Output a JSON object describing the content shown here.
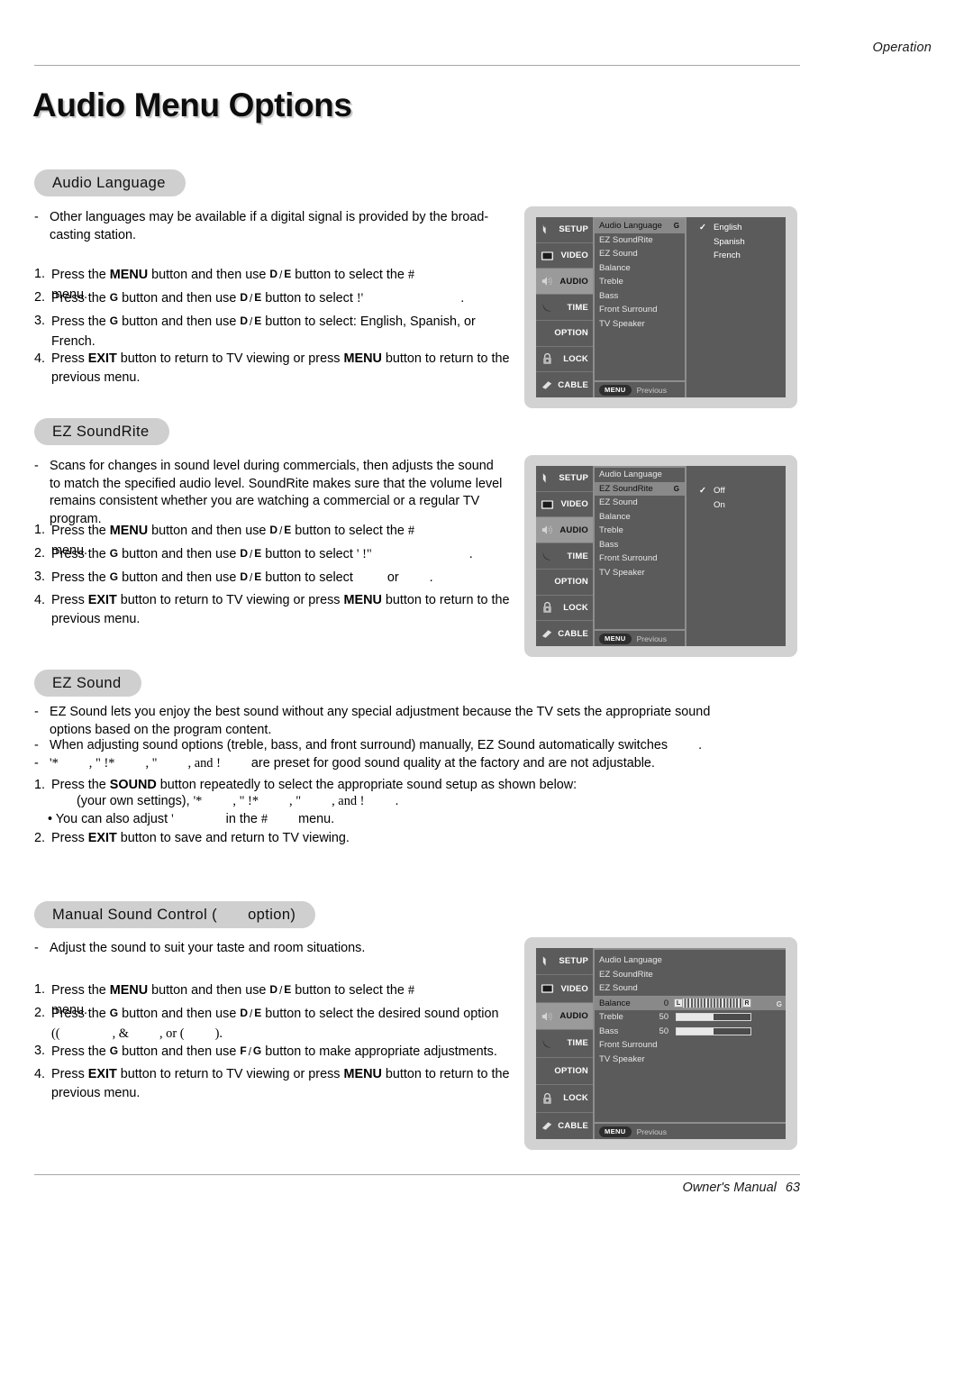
{
  "header": {
    "running_head": "Operation"
  },
  "title": "Audio Menu Options",
  "footer": {
    "manual_label": "Owner's Manual",
    "page_number": "63"
  },
  "sections": {
    "audio_language": {
      "pill": "Audio Language",
      "note": "Other languages may be available if a digital signal is provided by the broad-casting station.",
      "note_l1": "Other languages may be available if a digital signal is provided by the broad-",
      "note_l2": "casting station.",
      "steps": [
        {
          "n": "1.",
          "pre": "Press the ",
          "b1": "MENU",
          "mid": " button and then use ",
          "k1": "D",
          "sep": "/",
          "k2": "E",
          "post": " button to select the ",
          "sym": "#",
          "tail": "menu."
        },
        {
          "n": "2.",
          "pre": "Press the ",
          "k1": "G",
          "mid": " button and then use ",
          "k2": "D",
          "sep": "/",
          "k3": "E",
          "post": " button to select ",
          "sym": "!'",
          "tail": "."
        },
        {
          "n": "3.",
          "pre": "Press the ",
          "k1": "G",
          "mid": " button and then use ",
          "k2": "D",
          "sep": "/",
          "k3": "E",
          "post": " button to select: English, Spanish, or",
          "l2": "French."
        },
        {
          "n": "4.",
          "pre": "Press ",
          "b1": "EXIT",
          "mid": " button to return to TV viewing or press ",
          "b2": "MENU",
          "post": " button to return to the",
          "l2": "previous menu."
        }
      ]
    },
    "ez_soundrite": {
      "pill": "EZ SoundRite",
      "note_l1": "Scans for changes in sound level during commercials, then adjusts the sound",
      "note_l2": "to match the specified audio level. SoundRite makes sure that the volume level",
      "note_l3": "remains consistent whether you are watching a commercial or a regular TV",
      "note_l4": "program.",
      "steps": [
        {
          "n": "1.",
          "pre": "Press the ",
          "b1": "MENU",
          "mid": " button and then use ",
          "k1": "D",
          "sep": "/",
          "k2": "E",
          "post": " button to select the ",
          "sym": "#",
          "tail": "menu."
        },
        {
          "n": "2.",
          "pre": "Press the ",
          "k1": "G",
          "mid": " button and then use ",
          "k2": "D",
          "sep": "/",
          "k3": "E",
          "post": " button to select ",
          "sym": "' !\"",
          "tail": "."
        },
        {
          "n": "3.",
          "pre": "Press the ",
          "k1": "G",
          "mid": " button and then use ",
          "k2": "D",
          "sep": "/",
          "k3": "E",
          "post": " button to select ",
          "sym": "",
          "tail": "or",
          "tail2": "."
        },
        {
          "n": "4.",
          "pre": "Press ",
          "b1": "EXIT",
          "mid": " button to return to TV viewing or press ",
          "b2": "MENU",
          "post": " button to return to the",
          "l2": "previous menu."
        }
      ]
    },
    "ez_sound": {
      "pill": "EZ Sound",
      "note1_l1": "EZ Sound lets you enjoy the best sound without any special adjustment because the TV sets the appropriate sound",
      "note1_l2": "options based on the program content.",
      "note2": "When adjusting sound options (treble, bass, and front surround) manually, EZ Sound automatically switches",
      "note2_tail": ".",
      "note3_a": "'*",
      "note3_b": ", \" !*",
      "note3_c": ", \"",
      "note3_d": ", and  !",
      "note3_tail": "are preset for good sound quality at the factory and are not adjustable.",
      "step1_pre": "Press the ",
      "step1_b": "SOUND",
      "step1_post": " button repeatedly to select the appropriate sound setup as shown below:",
      "step1_sub_pre": "(your own settings), ",
      "step1_sub_a": "'*",
      "step1_sub_b": ", \" !*",
      "step1_sub_c": ", \"",
      "step1_sub_d": ", and  !",
      "step1_sub_tail": ".",
      "bullet_pre": "You can also adjust ",
      "bullet_sym1": "'",
      "bullet_mid": "in the ",
      "bullet_sym2": "#",
      "bullet_tail": "menu.",
      "step2_n": "2.",
      "step2_pre": "Press ",
      "step2_b": "EXIT",
      "step2_post": " button to save and return to TV viewing.",
      "step1_n": "1."
    },
    "manual_sound_control": {
      "pill_pre": "Manual Sound Control (",
      "pill_sym": "",
      "pill_post": "option)",
      "note": "Adjust the sound to suit your taste and room situations.",
      "steps": [
        {
          "n": "1.",
          "pre": "Press the ",
          "b1": "MENU",
          "mid": " button and then use ",
          "k1": "D",
          "sep": "/",
          "k2": "E",
          "post": " button to select the ",
          "sym": "#",
          "tail": "menu."
        },
        {
          "n": "2.",
          "pre": "Press the ",
          "k1": "G",
          "mid": " button and then use ",
          "k2": "D",
          "sep": "/",
          "k3": "E",
          "post": " button to select the desired sound option",
          "l2a": "((",
          "l2b": ",  &",
          "l2c": ", or (",
          "l2d": ")."
        },
        {
          "n": "3.",
          "pre": "Press the ",
          "k1": "G",
          "mid": " button and then use ",
          "k2": "F",
          "sep": "/",
          "k3": "G",
          "post": " button to make appropriate adjustments."
        },
        {
          "n": "4.",
          "pre": "Press ",
          "b1": "EXIT",
          "mid": " button to return to TV viewing or press ",
          "b2": "MENU",
          "post": " button to return to the",
          "l2": "previous menu."
        }
      ]
    }
  },
  "osd": {
    "sidebar": [
      {
        "label": "SETUP",
        "icon": "antenna-icon",
        "active": false
      },
      {
        "label": "VIDEO",
        "icon": "screen-icon",
        "active": false
      },
      {
        "label": "AUDIO",
        "icon": "speaker-waves-icon",
        "active": true
      },
      {
        "label": "TIME",
        "icon": "crescent-icon",
        "active": false
      },
      {
        "label": "OPTION",
        "icon": "none",
        "active": false
      },
      {
        "label": "LOCK",
        "icon": "padlock-icon",
        "active": false
      },
      {
        "label": "CABLE",
        "icon": "cable-plug-icon",
        "active": false
      }
    ],
    "menu_items": [
      "Audio Language",
      "EZ SoundRite",
      "EZ Sound",
      "Balance",
      "Treble",
      "Bass",
      "Front Surround",
      "TV Speaker"
    ],
    "arrow_glyph": "G",
    "check_glyph": "✓",
    "footer_chip": "MENU",
    "footer_label": "Previous",
    "screen1": {
      "highlight": "Audio Language",
      "options": [
        {
          "label": "English",
          "checked": true
        },
        {
          "label": "Spanish",
          "checked": false
        },
        {
          "label": "French",
          "checked": false
        }
      ]
    },
    "screen2": {
      "highlight": "EZ SoundRite",
      "options": [
        {
          "label": "Off",
          "checked": true
        },
        {
          "label": "On",
          "checked": false
        }
      ]
    },
    "screen3": {
      "highlight": "Balance",
      "sliders": [
        {
          "label": "Balance",
          "value": "0",
          "type": "balance",
          "left_cap": "L",
          "right_cap": "R"
        },
        {
          "label": "Treble",
          "value": "50",
          "type": "bar",
          "fill_pct": 50
        },
        {
          "label": "Bass",
          "value": "50",
          "type": "bar",
          "fill_pct": 50
        }
      ]
    }
  }
}
